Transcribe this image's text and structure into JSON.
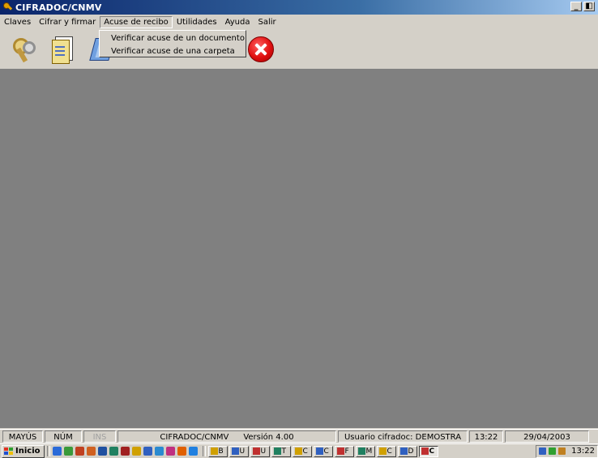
{
  "window": {
    "title": "CIFRADOC/CNMV",
    "minimize_label": "_",
    "restore_label": "◧"
  },
  "menubar": {
    "items": [
      "Claves",
      "Cifrar y firmar",
      "Acuse de recibo",
      "Utilidades",
      "Ayuda",
      "Salir"
    ],
    "active_index": 2
  },
  "dropdown": {
    "items": [
      "Verificar acuse de un documento",
      "Verificar acuse de una carpeta"
    ]
  },
  "toolbar": {
    "icons": [
      "keys-icon",
      "document-icon",
      "blue-document-icon",
      "close-icon"
    ]
  },
  "statusbar": {
    "caps": "MAYÚS",
    "num": "NÚM",
    "ins": "INS",
    "app": "CIFRADOC/CNMV",
    "version": "Versión 4.00",
    "user": "Usuario cifradoc: DEMOSTRA",
    "time": "13:22",
    "date": "29/04/2003"
  },
  "taskbar": {
    "start_label": "Inicio",
    "quicklaunch_colors": [
      "#2a6ad8",
      "#3a9a3a",
      "#c04020",
      "#d06020",
      "#2050a0",
      "#208060",
      "#a02020",
      "#d0a000",
      "#3060c0",
      "#2a8ad0",
      "#c03080",
      "#e06000",
      "#2080e0"
    ],
    "task_labels": [
      "B",
      "U",
      "U",
      "T",
      "C",
      "C",
      "F",
      "M",
      "C",
      "D",
      "C"
    ],
    "active_task_index": 10,
    "clock": "13:22"
  },
  "colors": {
    "workspace": "#808080",
    "chrome": "#d4d0c8",
    "title_start": "#0a246a",
    "title_end": "#a6caf0"
  }
}
